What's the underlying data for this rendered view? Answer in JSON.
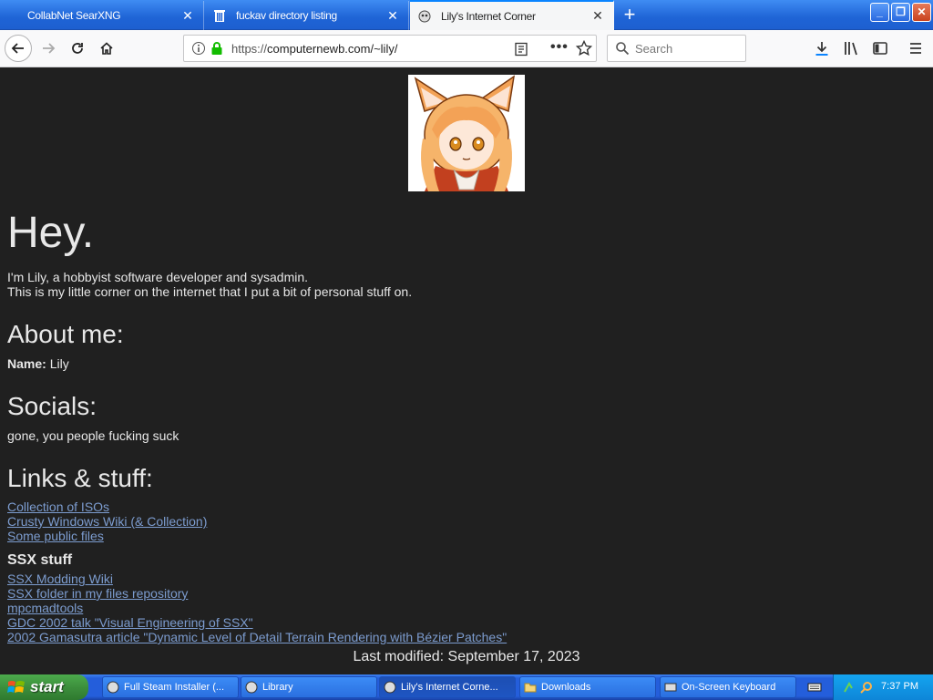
{
  "browser": {
    "tabs": [
      {
        "title": "CollabNet SearXNG",
        "active": false
      },
      {
        "title": "fuckav directory listing",
        "active": false
      },
      {
        "title": "Lily's Internet Corner",
        "active": true
      }
    ],
    "url_prefix": "https://",
    "url_main": "computernewb.com/~lily/",
    "search_placeholder": "Search"
  },
  "page": {
    "heading": "Hey.",
    "intro_line1": "I'm Lily, a hobbyist software developer and sysadmin.",
    "intro_line2": "This is my little corner on the internet that I put a bit of personal stuff on.",
    "about_heading": "About me:",
    "name_label": "Name:",
    "name_value": "Lily",
    "socials_heading": "Socials:",
    "socials_text": "gone, you people fucking suck",
    "links_heading": "Links & stuff:",
    "links": [
      "Collection of ISOs",
      "Crusty Windows Wiki (& Collection)",
      "Some public files"
    ],
    "ssx_heading": "SSX stuff",
    "ssx_links": [
      "SSX Modding Wiki",
      "SSX folder in my files repository",
      "mpcmadtools",
      "GDC 2002 talk \"Visual Engineering of SSX\"",
      "2002 Gamasutra article \"Dynamic Level of Detail Terrain Rendering with Bézier Patches\""
    ],
    "footer": "Last modified: September 17, 2023"
  },
  "taskbar": {
    "start_label": "start",
    "tasks": [
      {
        "label": "Full Steam Installer (...",
        "active": false
      },
      {
        "label": "Library",
        "active": false
      },
      {
        "label": "Lily's Internet Corne...",
        "active": true
      },
      {
        "label": "Downloads",
        "active": false
      },
      {
        "label": "On-Screen Keyboard",
        "active": false
      }
    ],
    "clock": "7:37 PM"
  },
  "colors": {
    "page_bg": "#202020",
    "link": "#7c9ccf",
    "tab_accent": "#0a84ff",
    "taskbar_blue": "#245edb",
    "start_green": "#3c8f3c"
  }
}
